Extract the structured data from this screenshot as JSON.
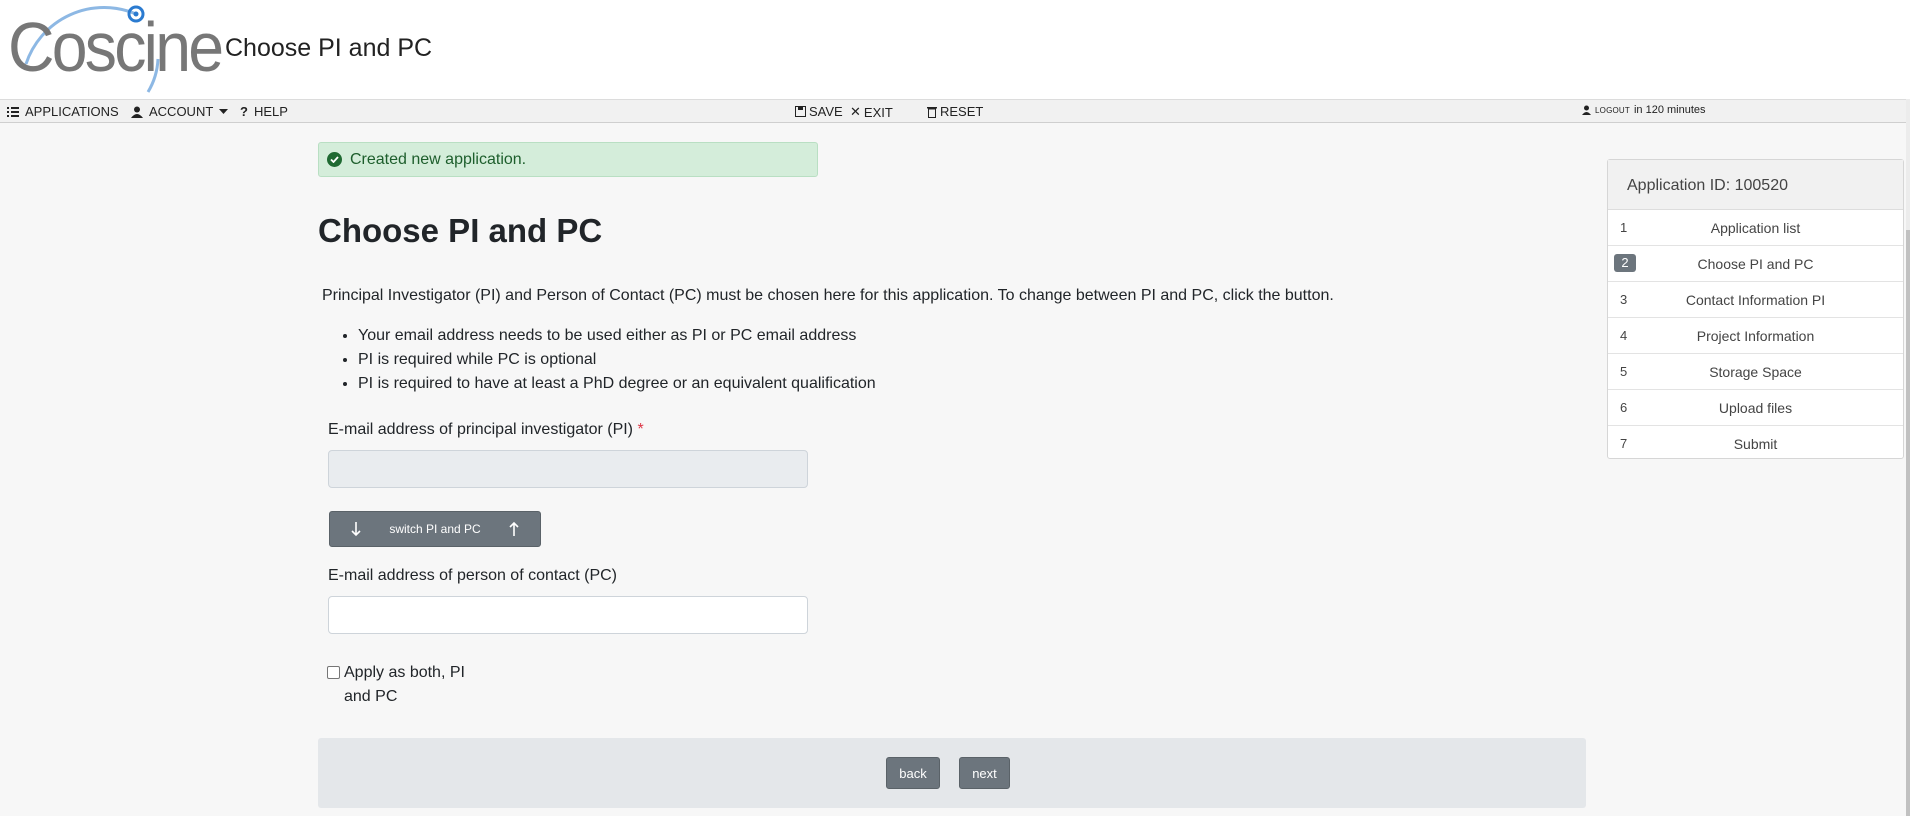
{
  "header": {
    "logo_text": "Coscine",
    "title": "Choose PI and PC"
  },
  "toolbar": {
    "applications": "APPLICATIONS",
    "account": "ACCOUNT",
    "help": "HELP",
    "save": "SAVE",
    "exit": "EXIT",
    "reset": "RESET",
    "logout": "LOGOUT",
    "session_time": "in 120 minutes"
  },
  "alert": {
    "message": "Created new application."
  },
  "main": {
    "title": "Choose PI and PC",
    "intro": "Principal Investigator (PI) and Person of Contact (PC) must be chosen here for this application. To change between PI and PC, click the button.",
    "rules": [
      "Your email address needs to be used either as PI or PC email address",
      "PI is required while PC is optional",
      "PI is required to have at least a PhD degree or an equivalent qualification"
    ],
    "pi_label": "E-mail address of principal investigator (PI)",
    "required_mark": "*",
    "pi_value": "",
    "switch_label": "switch PI and PC",
    "pc_label": "E-mail address of person of contact (PC)",
    "pc_value": "",
    "both_label": "Apply as both, PI and PC",
    "back": "back",
    "next": "next"
  },
  "side": {
    "title": "Application ID: 100520",
    "steps": [
      {
        "num": "1",
        "label": "Application list"
      },
      {
        "num": "2",
        "label": "Choose PI and PC"
      },
      {
        "num": "3",
        "label": "Contact Information PI"
      },
      {
        "num": "4",
        "label": "Project Information"
      },
      {
        "num": "5",
        "label": "Storage Space"
      },
      {
        "num": "6",
        "label": "Upload files"
      },
      {
        "num": "7",
        "label": "Submit"
      }
    ],
    "active_step": "2"
  },
  "colors": {
    "accent": "#6c757d",
    "success_bg": "#d4edda",
    "logo_blue": "#6aa4d9"
  }
}
